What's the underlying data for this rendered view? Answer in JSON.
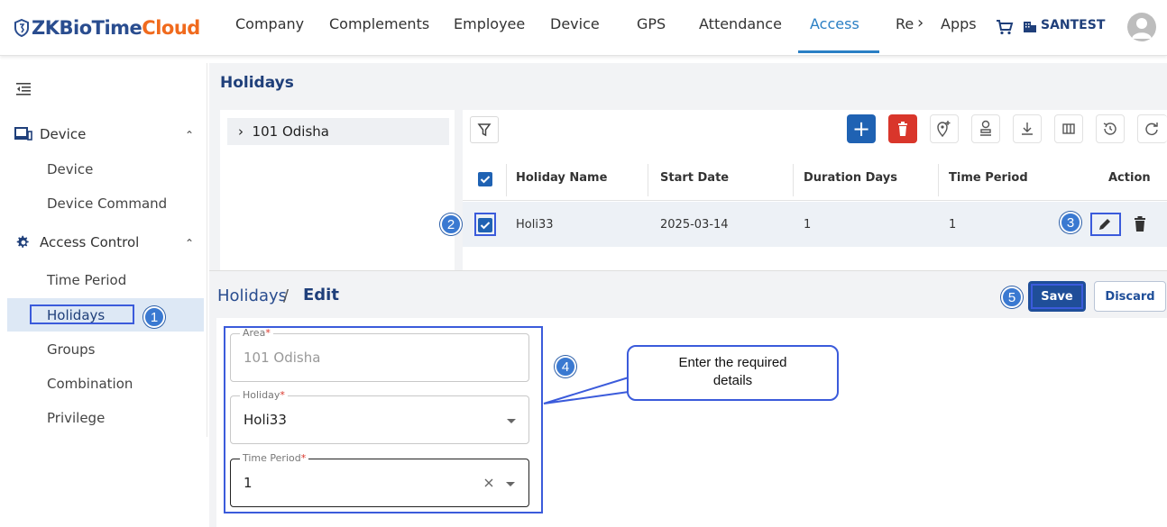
{
  "header": {
    "logo_part1": "ZKBioTime",
    "logo_part2": "Cloud",
    "nav": [
      "Company",
      "Complements",
      "Employee",
      "Device",
      "GPS",
      "Attendance",
      "Access",
      "Re",
      "Apps"
    ],
    "nav_active": "Access",
    "nav_more": "›",
    "company": "SANTEST"
  },
  "sidebar": {
    "groups": [
      {
        "label": "Device",
        "items": [
          "Device",
          "Device Command"
        ]
      },
      {
        "label": "Access Control",
        "items": [
          "Time Period",
          "Holidays",
          "Groups",
          "Combination",
          "Privilege"
        ]
      }
    ],
    "selected": "Holidays"
  },
  "page": {
    "title": "Holidays",
    "tree_item": "101 Odisha",
    "tree_chevron": "›"
  },
  "table": {
    "columns": [
      "Holiday Name",
      "Start Date",
      "Duration Days",
      "Time Period",
      "Action"
    ],
    "rows": [
      {
        "holiday_name": "Holi33",
        "start_date": "2025-03-14",
        "duration_days": "1",
        "time_period": "1"
      }
    ]
  },
  "edit": {
    "breadcrumb_parent": "Holidays",
    "breadcrumb_sep": "/",
    "breadcrumb_current": "Edit",
    "save_label": "Save",
    "discard_label": "Discard",
    "fields": {
      "area": {
        "label": "Area",
        "value": "101 Odisha"
      },
      "holiday": {
        "label": "Holiday",
        "value": "Holi33"
      },
      "time_period": {
        "label": "Time Period",
        "value": "1"
      }
    },
    "required_marker": "*"
  },
  "annotations": {
    "steps": [
      "1",
      "2",
      "3",
      "4",
      "5"
    ],
    "callout_line1": "Enter the required",
    "callout_line2": "details"
  },
  "colors": {
    "primary": "#1f62b3",
    "danger": "#d9362b",
    "annotation": "#3b5bdb",
    "badge": "#3a79d1"
  }
}
